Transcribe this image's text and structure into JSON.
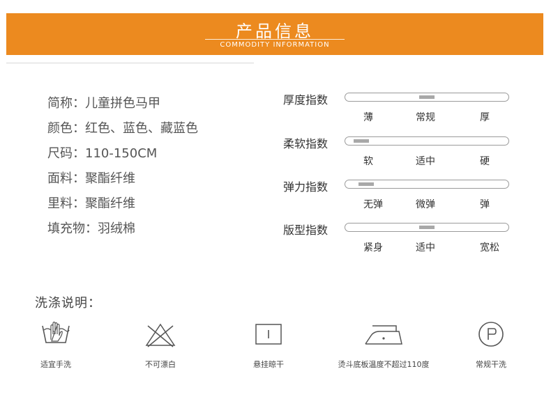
{
  "header": {
    "title": "产品信息",
    "subtitle": "COMMODITY INFORMATION",
    "background": "#ec8a1f"
  },
  "info": [
    {
      "key": "简称：",
      "value": "儿童拼色马甲"
    },
    {
      "key": "颜色：",
      "value": "红色、蓝色、藏蓝色"
    },
    {
      "key": "尺码：",
      "value": "110-150CM"
    },
    {
      "key": "面料：",
      "value": "聚酯纤维"
    },
    {
      "key": "里料：",
      "value": "聚酯纤维"
    },
    {
      "key": "填充物：",
      "value": "羽绒棉"
    }
  ],
  "scales": [
    {
      "title": "厚度指数",
      "labels": [
        "薄",
        "常规",
        "厚"
      ],
      "level": 0.5
    },
    {
      "title": "柔软指数",
      "labels": [
        "软",
        "适中",
        "硬"
      ],
      "level": 0.1
    },
    {
      "title": "弹力指数",
      "labels": [
        "无弹",
        "微弹",
        "弹"
      ],
      "level": 0.13
    },
    {
      "title": "版型指数",
      "labels": [
        "紧身",
        "适中",
        "宽松"
      ],
      "level": 0.5
    }
  ],
  "wash": {
    "title": "洗涤说明：",
    "items": [
      {
        "icon": "hand-wash-icon",
        "label": "适宜手洗"
      },
      {
        "icon": "no-bleach-icon",
        "label": "不可漂白"
      },
      {
        "icon": "hang-dry-icon",
        "label": "悬挂晾干"
      },
      {
        "icon": "iron-low-temp-icon",
        "label": "烫斗底板温度不超过110度"
      },
      {
        "icon": "dry-clean-icon",
        "label": "常规干洗"
      }
    ]
  }
}
